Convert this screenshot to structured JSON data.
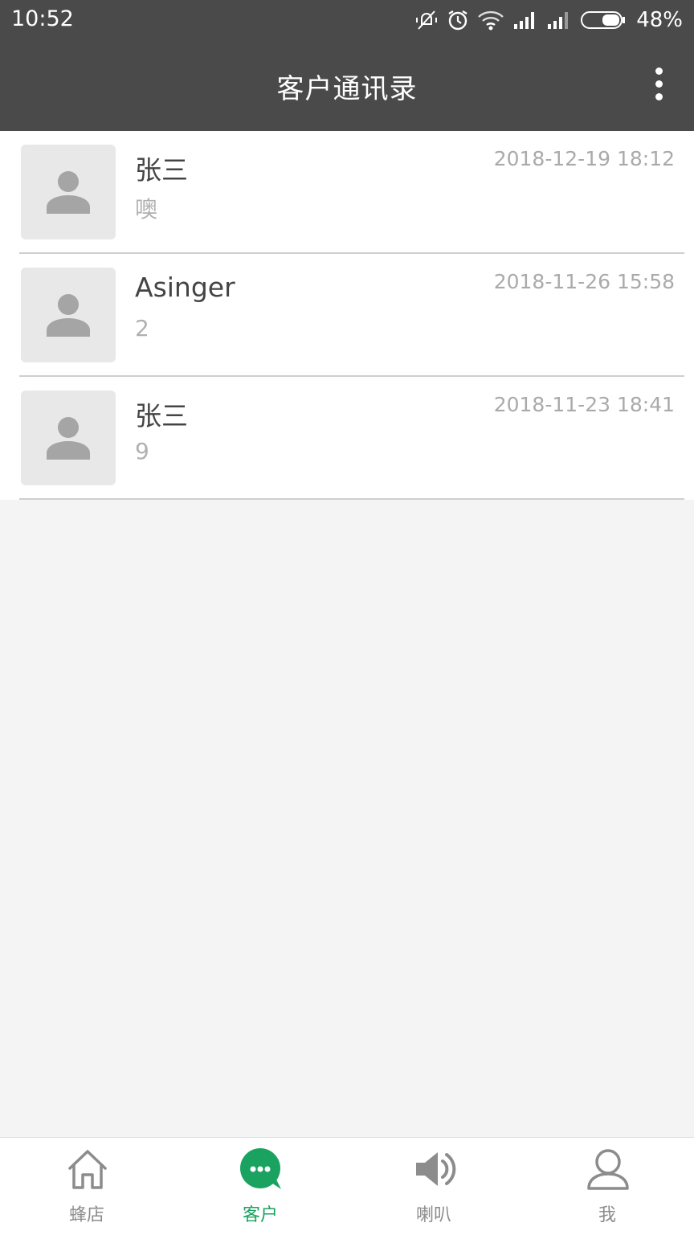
{
  "status_bar": {
    "time": "10:52",
    "battery": "48%"
  },
  "header": {
    "title": "客户通讯录"
  },
  "contacts": [
    {
      "name": "张三",
      "last_message": "噢",
      "time": "2018-12-19 18:12"
    },
    {
      "name": "Asinger",
      "last_message": "2",
      "time": "2018-11-26 15:58"
    },
    {
      "name": "张三",
      "last_message": "9",
      "time": "2018-11-23 18:41"
    }
  ],
  "tabs": [
    {
      "label": "蜂店",
      "icon": "home-icon"
    },
    {
      "label": "客户",
      "icon": "chat-bubble-icon",
      "active": true
    },
    {
      "label": "喇叭",
      "icon": "speaker-icon"
    },
    {
      "label": "我",
      "icon": "person-icon"
    }
  ],
  "colors": {
    "header_bg": "#4a4a4a",
    "accent": "#1aa260",
    "list_bg": "#ffffff",
    "page_bg": "#f4f4f4"
  }
}
